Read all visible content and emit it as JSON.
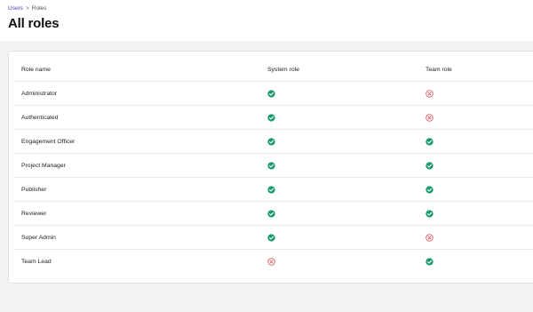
{
  "breadcrumb": {
    "parent": "Users",
    "separator": ">",
    "current": "Roles"
  },
  "page": {
    "title": "All roles"
  },
  "table": {
    "headers": {
      "role_name": "Role name",
      "system_role": "System role",
      "team_role": "Team role"
    },
    "rows": [
      {
        "name": "Administrator",
        "system_role": true,
        "team_role": false
      },
      {
        "name": "Authenticated",
        "system_role": true,
        "team_role": false
      },
      {
        "name": "Engagement Officer",
        "system_role": true,
        "team_role": true
      },
      {
        "name": "Project Manager",
        "system_role": true,
        "team_role": true
      },
      {
        "name": "Publisher",
        "system_role": true,
        "team_role": true
      },
      {
        "name": "Reviewer",
        "system_role": true,
        "team_role": true
      },
      {
        "name": "Super Admin",
        "system_role": true,
        "team_role": false
      },
      {
        "name": "Team Lead",
        "system_role": false,
        "team_role": true
      }
    ]
  },
  "icons": {
    "yes": "check-circle-icon",
    "no": "x-circle-icon"
  },
  "colors": {
    "yes": "#1a9a6c",
    "no": "#e0484f",
    "link": "#4b3fd6"
  }
}
